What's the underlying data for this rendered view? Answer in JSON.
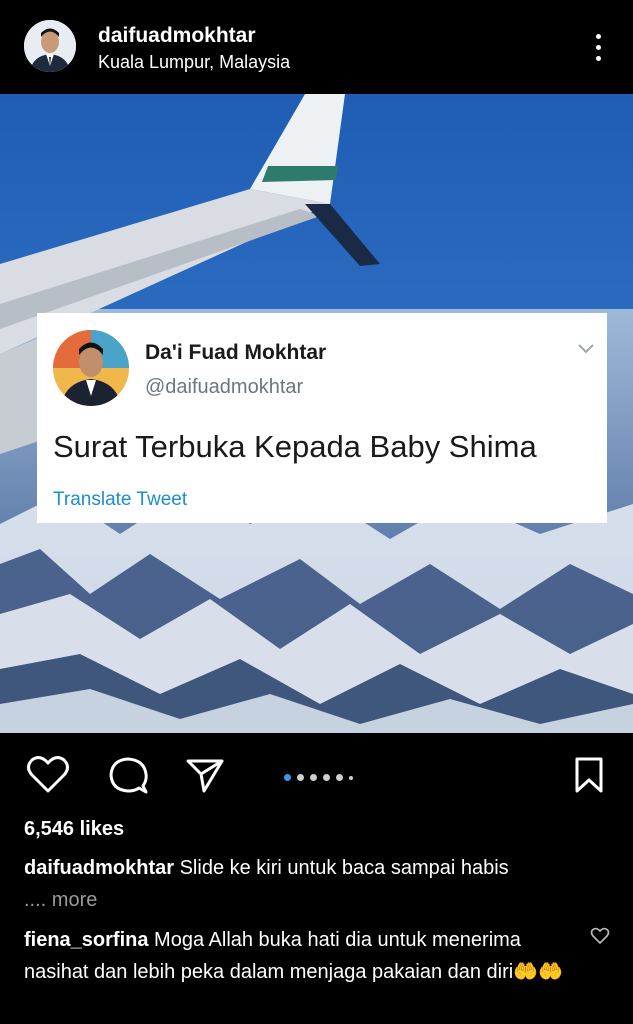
{
  "post": {
    "username": "daifuadmokhtar",
    "location": "Kuala Lumpur, Malaysia"
  },
  "tweet": {
    "display_name": "Da'i Fuad Mokhtar",
    "handle": "@daifuadmokhtar",
    "text": "Surat Terbuka Kepada Baby Shima",
    "translate": "Translate Tweet"
  },
  "carousel": {
    "count": 6,
    "active_index": 0
  },
  "likes": "6,546 likes",
  "caption": {
    "username": "daifuadmokhtar",
    "text": "Slide ke kiri untuk baca sampai habis",
    "ellipsis": "....",
    "more": "more"
  },
  "comment": {
    "username": "fiena_sorfina",
    "text": "Moga Allah buka hati dia untuk menerima nasihat dan lebih peka dalam menjaga pakaian dan diri",
    "emoji": "🤲🤲"
  },
  "colors": {
    "link": "#1d8cd2",
    "active_dot": "#3897f0",
    "sky": "#2d6fc4"
  }
}
